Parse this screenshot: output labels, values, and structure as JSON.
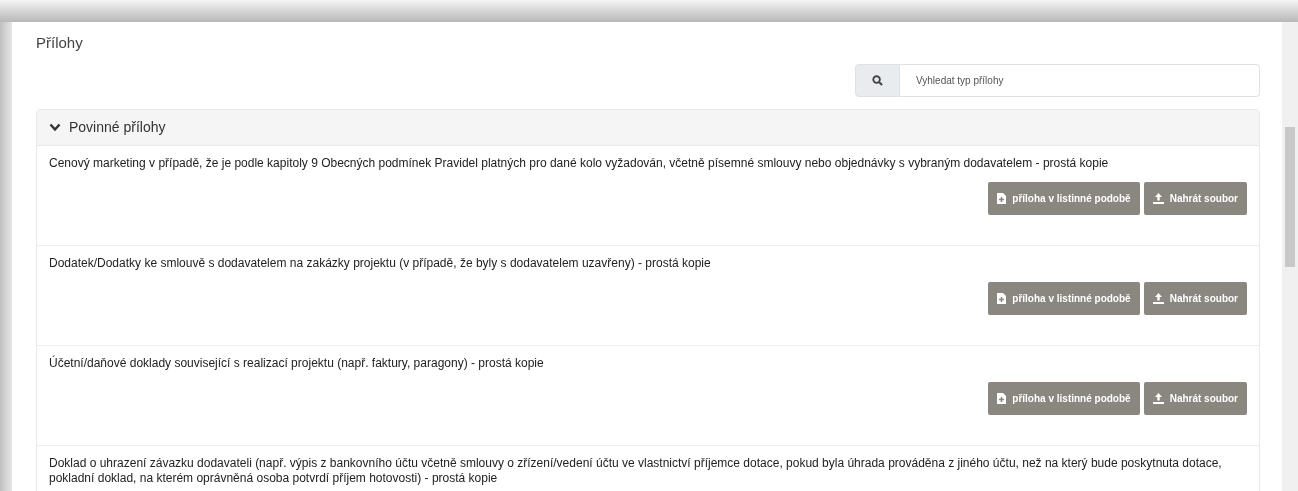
{
  "title": "Přílohy",
  "search": {
    "placeholder": "Vyhledat typ přílohy"
  },
  "section": {
    "title": "Povinné přílohy",
    "expanded": true,
    "items": [
      {
        "text": "Cenový marketing v případě, že je podle kapitoly 9 Obecných podmínek Pravidel platných pro dané kolo vyžadován, včetně písemné smlouvy nebo objednávky s vybraným dodavatelem - prostá kopie",
        "buttons": [
          "příloha v listinné podobě",
          "Nahrát soubor"
        ]
      },
      {
        "text": "Dodatek/Dodatky ke smlouvě s dodavatelem na zakázky projektu (v případě, že byly s dodavatelem uzavřeny) - prostá kopie",
        "buttons": [
          "příloha v listinné podobě",
          "Nahrát soubor"
        ]
      },
      {
        "text": "Účetní/daňové doklady související s realizací projektu (např. faktury, paragony) - prostá kopie",
        "buttons": [
          "příloha v listinné podobě",
          "Nahrát soubor"
        ]
      },
      {
        "text": "Doklad o uhrazení závazku dodavateli (např. výpis z bankovního účtu včetně smlouvy o zřízení/vedení účtu ve vlastnictví příjemce dotace, pokud byla úhrada prováděna z jiného účtu, než na který bude poskytnuta dotace, pokladní doklad, na kterém oprávněná osoba potvrdí příjem hotovosti) - prostá kopie"
      }
    ]
  }
}
